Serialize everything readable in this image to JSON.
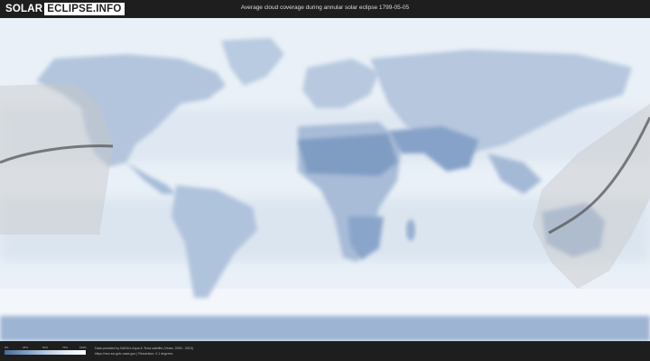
{
  "header": {
    "logo_word": "SOLAR",
    "logo_box": "ECLIPSE.INFO",
    "title": "Average cloud coverage during annular solar eclipse 1799-05-05"
  },
  "legend": {
    "ticks": [
      "0%",
      "25%",
      "50%",
      "75%",
      "100%"
    ],
    "colors": [
      "#4b6a96",
      "#7e9bc0",
      "#b6c9df",
      "#e2ebf4",
      "#ffffff"
    ]
  },
  "footer": {
    "credit_line1": "Data provided by NASA's Aqua & Terra satellite (Years: 2000 - 2019)",
    "credit_line2": "https://neo.sci.gsfc.nasa.gov | Resolution: 0.1 degrees"
  },
  "map": {
    "ocean_color": "#eef3f8",
    "land_cloud_colors": [
      "#a9bcd6",
      "#7f9cc3",
      "#c8d6e8"
    ],
    "eclipse_path_color": "#555555",
    "eclipse_zone_color": "#c8c8c8"
  }
}
